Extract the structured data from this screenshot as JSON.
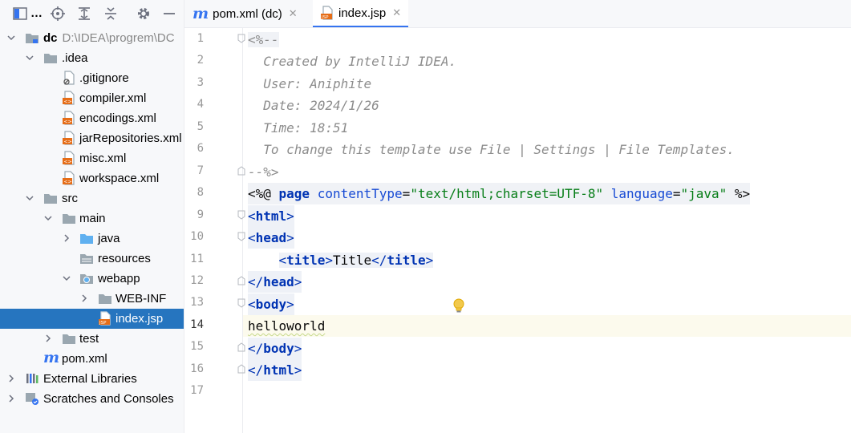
{
  "project_panel": {
    "title": "…",
    "tree": [
      {
        "name": "dc",
        "path": "D:\\IDEA\\progrem\\DC",
        "bold": true
      },
      {
        "name": ".idea"
      },
      {
        "name": ".gitignore"
      },
      {
        "name": "compiler.xml"
      },
      {
        "name": "encodings.xml"
      },
      {
        "name": "jarRepositories.xml"
      },
      {
        "name": "misc.xml"
      },
      {
        "name": "workspace.xml"
      },
      {
        "name": "src"
      },
      {
        "name": "main"
      },
      {
        "name": "java"
      },
      {
        "name": "resources"
      },
      {
        "name": "webapp"
      },
      {
        "name": "WEB-INF"
      },
      {
        "name": "index.jsp",
        "selected": true
      },
      {
        "name": "test"
      },
      {
        "name": "pom.xml"
      },
      {
        "name": "External Libraries"
      },
      {
        "name": "Scratches and Consoles"
      }
    ]
  },
  "tabs": [
    {
      "label": "pom.xml (dc)",
      "icon": "maven-icon"
    },
    {
      "label": "index.jsp",
      "icon": "jsp-icon",
      "active": true
    }
  ],
  "editor": {
    "line_numbers": [
      "1",
      "2",
      "3",
      "4",
      "5",
      "6",
      "7",
      "8",
      "9",
      "10",
      "11",
      "12",
      "13",
      "14",
      "15",
      "16",
      "17"
    ],
    "current_line": 14,
    "lines": {
      "l1": "<%--",
      "l2": "  Created by IntelliJ IDEA.",
      "l3": "  User: Aniphite",
      "l4": "  Date: 2024/1/26",
      "l5": "  Time: 18:51",
      "l6": "  To change this template use File | Settings | File Templates.",
      "l7": "--%>",
      "l8": {
        "open": "<%@ ",
        "kw1": "page",
        "attr1": "contentType",
        "eq1": "=",
        "val1": "\"text/html;charset=UTF-8\"",
        "attr2": "language",
        "eq2": "=",
        "val2": "\"java\"",
        "close": " %>"
      },
      "l9": {
        "lt": "<",
        "tag": "html",
        "gt": ">"
      },
      "l10": {
        "lt": "<",
        "tag": "head",
        "gt": ">"
      },
      "l11": {
        "indent": "    ",
        "lt": "<",
        "tag": "title",
        "gt": ">",
        "text": "Title",
        "lt2": "</",
        "tag2": "title",
        "gt2": ">"
      },
      "l12": {
        "lt": "</",
        "tag": "head",
        "gt": ">"
      },
      "l13": {
        "lt": "<",
        "tag": "body",
        "gt": ">"
      },
      "l14": "helloworld",
      "l15": {
        "lt": "</",
        "tag": "body",
        "gt": ">"
      },
      "l16": {
        "lt": "</",
        "tag": "html",
        "gt": ">"
      }
    }
  },
  "colors": {
    "selection": "#2675bf",
    "accent": "#3574f0",
    "keyword": "#0033b3",
    "string": "#067d17",
    "comment": "#8c8c8c"
  }
}
